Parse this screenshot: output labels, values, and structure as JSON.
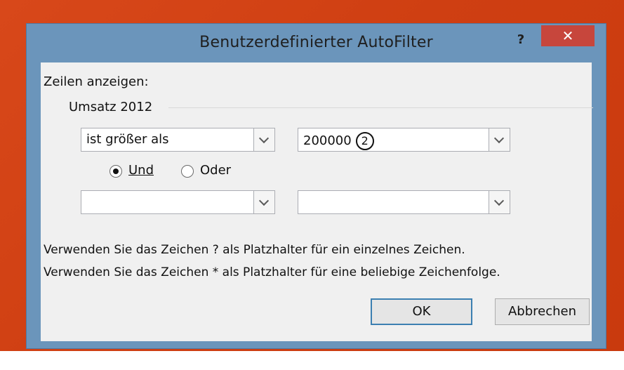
{
  "dialog": {
    "title": "Benutzerdefinierter AutoFilter",
    "help_label": "?",
    "close_label": "✕"
  },
  "content": {
    "show_rows_label": "Zeilen anzeigen:",
    "column_name": "Umsatz 2012",
    "condition1": {
      "operator": "ist größer als",
      "value": "200000",
      "marker": "2"
    },
    "logic": {
      "and_label": "Und",
      "or_label": "Oder",
      "selected": "Und"
    },
    "condition2": {
      "operator": "",
      "value": ""
    },
    "hint_line1": "Verwenden Sie das Zeichen ? als Platzhalter für ein einzelnes Zeichen.",
    "hint_line2": "Verwenden Sie das Zeichen * als Platzhalter für eine beliebige Zeichenfolge."
  },
  "buttons": {
    "ok_label": "OK",
    "cancel_label": "Abbrechen"
  }
}
